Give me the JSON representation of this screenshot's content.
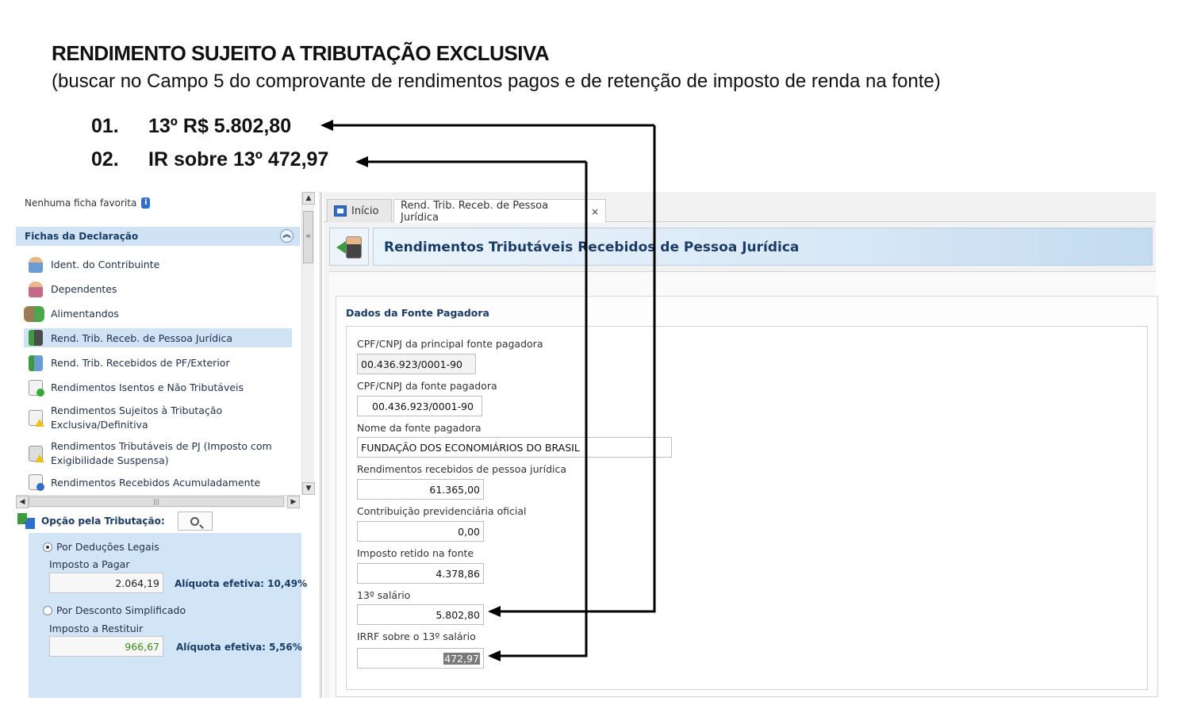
{
  "annotation": {
    "title": "RENDIMENTO SUJEITO A TRIBUTAÇÃO EXCLUSIVA",
    "subtitle": "(buscar no Campo 5 do comprovante de rendimentos pagos e de retenção de imposto de renda na fonte)",
    "items": [
      {
        "num": "01.",
        "text": "13º R$ 5.802,80"
      },
      {
        "num": "02.",
        "text": "IR sobre 13º 472,97"
      }
    ]
  },
  "sidebar": {
    "favorites_text": "Nenhuma ficha favorita",
    "section_title": "Fichas da Declaração",
    "items": [
      {
        "label": "Ident. do Contribuinte",
        "icon": "person-icon"
      },
      {
        "label": "Dependentes",
        "icon": "dependents-icon"
      },
      {
        "label": "Alimentandos",
        "icon": "alimentandos-icon"
      },
      {
        "label": "Rend. Trib. Receb. de Pessoa Jurídica",
        "icon": "rend-pj-icon",
        "selected": true
      },
      {
        "label": "Rend. Trib. Recebidos de PF/Exterior",
        "icon": "rend-pf-icon"
      },
      {
        "label": "Rendimentos Isentos e Não Tributáveis",
        "icon": "doc-check-icon"
      },
      {
        "label": "Rendimentos Sujeitos à Tributação Exclusiva/Definitiva",
        "icon": "doc-warning-icon"
      },
      {
        "label": "Rendimentos Tributáveis de PJ (Imposto com Exigibilidade Suspensa)",
        "icon": "doc-suspended-icon"
      },
      {
        "label": "Rendimentos Recebidos Acumuladamente",
        "icon": "doc-accumulated-icon"
      }
    ]
  },
  "tributacao": {
    "label": "Opção pela Tributação:",
    "deducoes": {
      "option": "Por Deduções Legais",
      "sub_label": "Imposto a Pagar",
      "value": "2.064,19",
      "aliquota": "Alíquota efetiva: 10,49%"
    },
    "simplificado": {
      "option": "Por Desconto Simplificado",
      "sub_label": "Imposto a Restituir",
      "value": "966,67",
      "aliquota": "Alíquota efetiva: 5,56%"
    }
  },
  "tabs": [
    {
      "label": "Início"
    },
    {
      "label": "Rend. Trib. Receb. de Pessoa Jurídica",
      "close": "×"
    }
  ],
  "page": {
    "title": "Rendimentos Tributáveis Recebidos de Pessoa Jurídica",
    "group_title": "Dados da Fonte Pagadora"
  },
  "form": {
    "cpf_principal_label": "CPF/CNPJ da principal fonte pagadora",
    "cpf_principal_value": "00.436.923/0001-90",
    "cpf_fonte_label": "CPF/CNPJ da fonte pagadora",
    "cpf_fonte_value": "00.436.923/0001-90",
    "nome_label": "Nome da fonte pagadora",
    "nome_value": "FUNDAÇÃO DOS ECONOMIÁRIOS DO BRASIL",
    "rendimentos_label": "Rendimentos recebidos de pessoa jurídica",
    "rendimentos_value": "61.365,00",
    "contrib_label": "Contribuição previdenciária oficial",
    "contrib_value": "0,00",
    "imposto_label": "Imposto retido na fonte",
    "imposto_value": "4.378,86",
    "decimo_label": "13º salário",
    "decimo_value": "5.802,80",
    "irrf_label": "IRRF sobre o 13º salário",
    "irrf_value": "472,97"
  },
  "colors": {
    "accent": "#1b3c66",
    "sidebar_selected": "#cfe3f5",
    "panel_blue": "#d2e5f6"
  }
}
